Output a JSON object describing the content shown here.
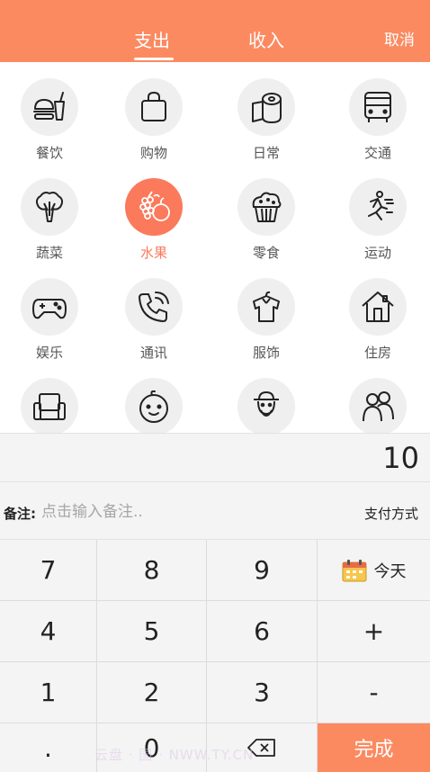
{
  "header": {
    "tabs": [
      {
        "label": "支出",
        "active": true
      },
      {
        "label": "收入",
        "active": false
      }
    ],
    "cancel_label": "取消"
  },
  "categories": [
    {
      "label": "餐饮",
      "icon": "food-icon",
      "active": false
    },
    {
      "label": "购物",
      "icon": "shopping-bag-icon",
      "active": false
    },
    {
      "label": "日常",
      "icon": "toilet-paper-icon",
      "active": false
    },
    {
      "label": "交通",
      "icon": "bus-icon",
      "active": false
    },
    {
      "label": "蔬菜",
      "icon": "vegetable-icon",
      "active": false
    },
    {
      "label": "水果",
      "icon": "fruit-icon",
      "active": true
    },
    {
      "label": "零食",
      "icon": "cupcake-icon",
      "active": false
    },
    {
      "label": "运动",
      "icon": "running-icon",
      "active": false
    },
    {
      "label": "娱乐",
      "icon": "gamepad-icon",
      "active": false
    },
    {
      "label": "通讯",
      "icon": "phone-icon",
      "active": false
    },
    {
      "label": "服饰",
      "icon": "shirt-icon",
      "active": false
    },
    {
      "label": "住房",
      "icon": "house-icon",
      "active": false
    },
    {
      "label": "",
      "icon": "sofa-icon",
      "active": false
    },
    {
      "label": "",
      "icon": "baby-icon",
      "active": false
    },
    {
      "label": "",
      "icon": "elder-icon",
      "active": false
    },
    {
      "label": "",
      "icon": "family-icon",
      "active": false
    }
  ],
  "amount": "10",
  "note": {
    "label": "备注:",
    "placeholder": "点击输入备注..",
    "pay_method_label": "支付方式"
  },
  "keypad": {
    "keys": [
      "7",
      "8",
      "9",
      "4",
      "5",
      "6",
      "+",
      "1",
      "2",
      "3",
      "-",
      ".",
      "0"
    ],
    "today_label": "今天",
    "done_label": "完成"
  },
  "watermark": "云盘 · 国 · NWW.TY.CN",
  "colors": {
    "accent": "#fb8a61",
    "active_category": "#fb7a5c",
    "icon_bg": "#efefef",
    "keypad_bg": "#f4f4f4"
  }
}
